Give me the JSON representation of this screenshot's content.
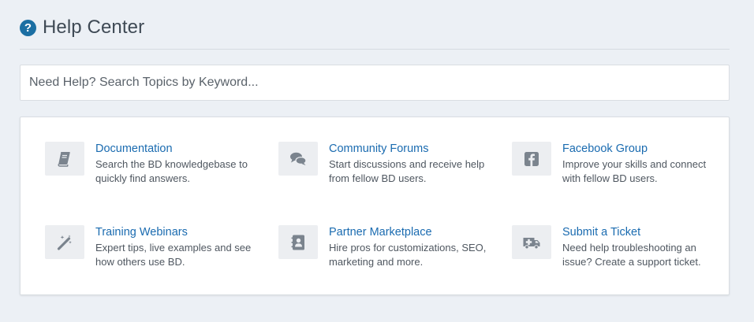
{
  "header": {
    "title": "Help Center",
    "icon": "question-circle-icon",
    "icon_glyph": "?"
  },
  "search": {
    "placeholder": "Need Help? Search Topics by Keyword..."
  },
  "colors": {
    "link": "#1a6bb0",
    "accent_icon": "#1b6fa3",
    "icon_gray": "#7b848e",
    "background": "#ecf0f5"
  },
  "topics": [
    {
      "title": "Documentation",
      "description": "Search the BD knowledgebase to quickly find answers.",
      "icon": "book-icon"
    },
    {
      "title": "Community Forums",
      "description": "Start discussions and receive help from fellow BD users.",
      "icon": "comments-icon"
    },
    {
      "title": "Facebook Group",
      "description": "Improve your skills and connect with fellow BD users.",
      "icon": "facebook-icon"
    },
    {
      "title": "Training Webinars",
      "description": "Expert tips, live examples and see how others use BD.",
      "icon": "magic-wand-icon"
    },
    {
      "title": "Partner Marketplace",
      "description": "Hire pros for customizations, SEO, marketing and more.",
      "icon": "address-book-icon"
    },
    {
      "title": "Submit a Ticket",
      "description": "Need help troubleshooting an issue? Create a support ticket.",
      "icon": "ambulance-icon"
    }
  ]
}
